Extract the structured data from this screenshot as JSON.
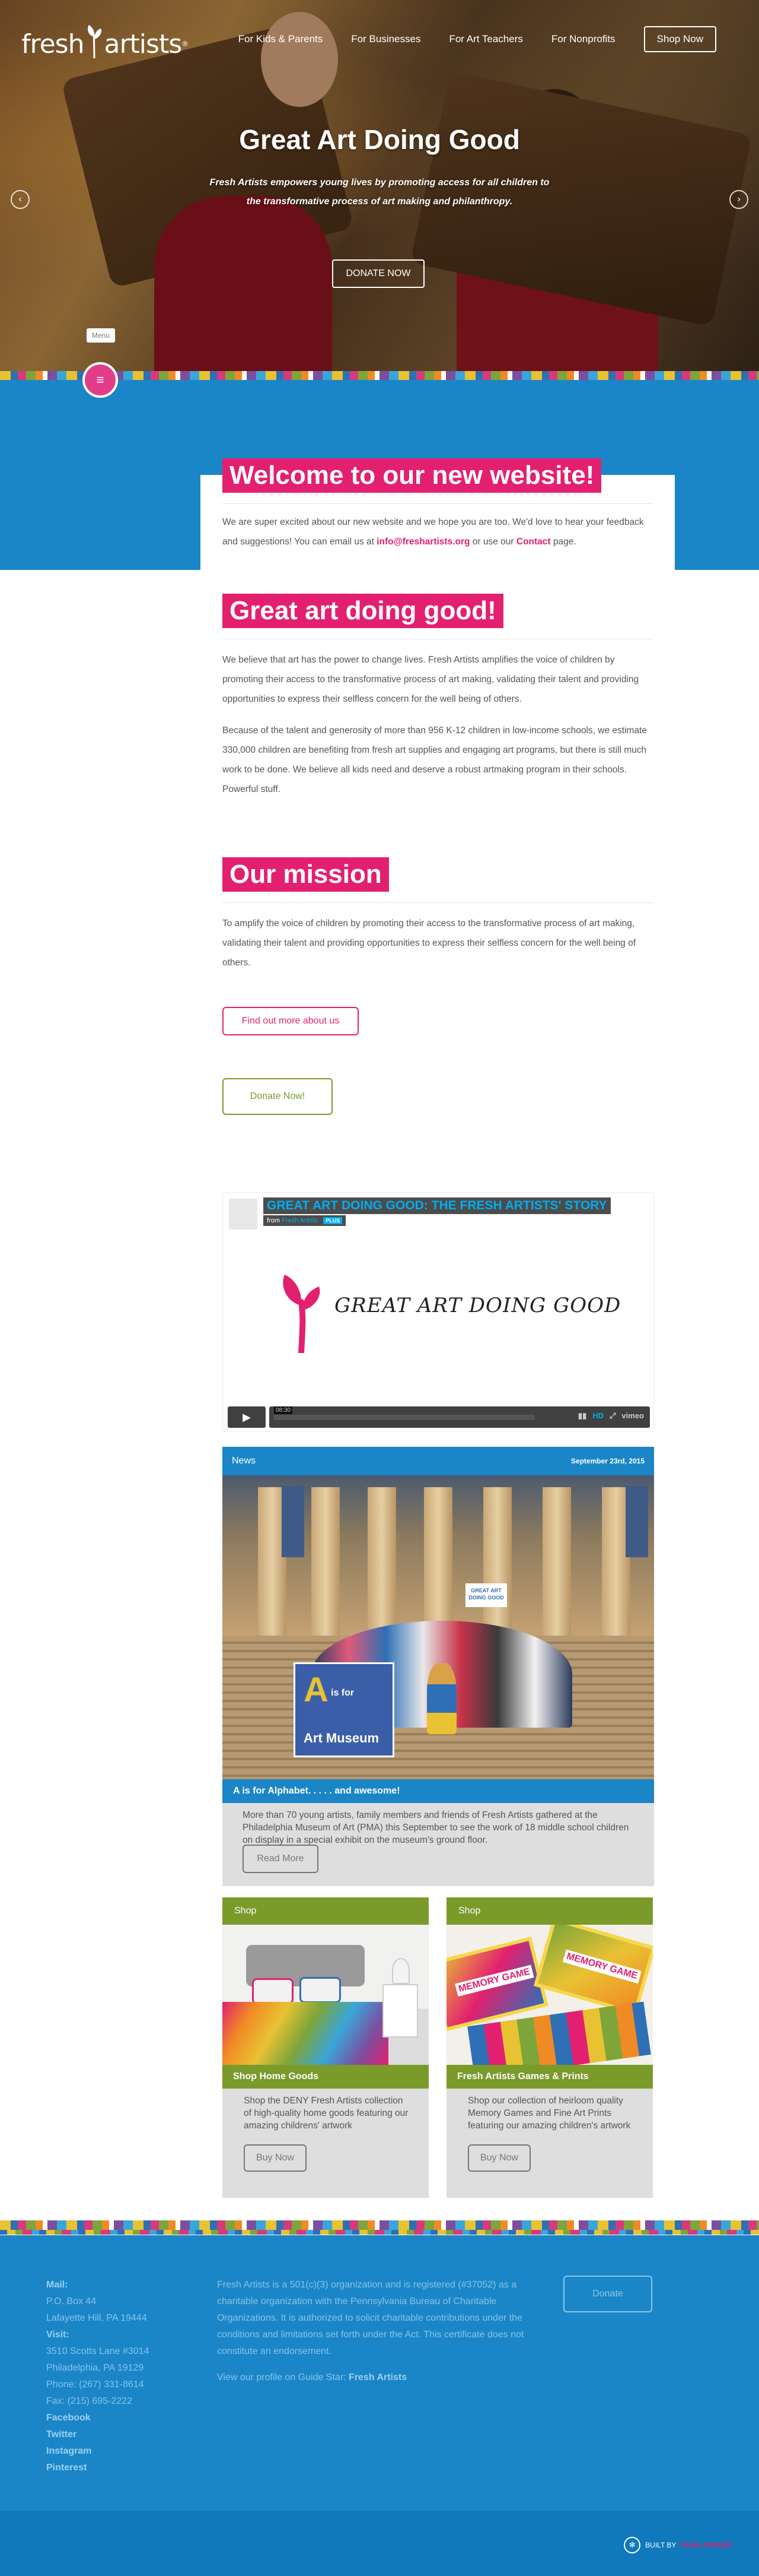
{
  "header": {
    "logo_left": "fresh",
    "logo_right": "artists",
    "logo_mark": "®",
    "nav": [
      "For Kids & Parents",
      "For Businesses",
      "For Art Teachers",
      "For Nonprofits"
    ],
    "shop_button": "Shop Now",
    "menu_label": "Menu"
  },
  "hero": {
    "title": "Great Art Doing Good",
    "subtitle": "Fresh Artists empowers young lives by promoting access for all children to the transformative process of art making and philanthropy.",
    "donate_button": "DONATE NOW"
  },
  "welcome": {
    "heading": "Welcome to our new website!",
    "text_before_email": "We are super excited about our new website and we hope you are too. We'd love to hear your feedback and suggestions! You can email us at ",
    "email": "info@freshartists.org",
    "text_middle": " or use our ",
    "contact_link": "Contact",
    "text_after": " page."
  },
  "great_art": {
    "heading": "Great art doing good!",
    "p1": "We believe that art has the power to change lives. Fresh Artists amplifies the voice of children by promoting their access to the transformative process of art making, validating their talent and providing opportunities to express their selfless concern for the well being of others.",
    "p2": "Because of the talent and generosity of more than 956 K-12 children in low-income schools, we estimate 330,000 children are benefiting from fresh art supplies and engaging art programs, but there is still much work to be done. We believe all kids need and deserve a robust artmaking program in their schools. Powerful stuff."
  },
  "mission": {
    "heading": "Our mission",
    "text": "To amplify the voice of children by promoting their access to the transformative process of art making, validating their talent and providing opportunities to express their selfless concern for the well being of others.",
    "about_button": "Find out more about us",
    "donate_button": "Donate Now!"
  },
  "video": {
    "title": "GREAT ART DOING GOOD: THE FRESH ARTISTS' STORY",
    "from": "from",
    "user": "Fresh Artists",
    "plus": "PLUS",
    "logo_text": "GREAT ART DOING GOOD",
    "time": "08:30",
    "hd": "HD",
    "vimeo": "vimeo"
  },
  "news": {
    "label": "News",
    "date": "September 23rd, 2015",
    "caption": "A is for Alphabet. . . . . and awesome!",
    "text": "More than 70 young artists, family members and friends of Fresh Artists gathered at the Philadelphia Museum of Art (PMA) this September to see the work of 18 middle school children on display in a special exhibit on the museum's ground floor.",
    "button": "Read More",
    "poster_line1": "A",
    "poster_line2": "is for",
    "poster_line3": "Art Museum",
    "sign_text": "GREAT ART DOING GOOD"
  },
  "shop_cards": [
    {
      "label": "Shop",
      "caption": "Shop Home Goods",
      "text": "Shop the DENY Fresh Artists collection of high-quality home goods featuring our amazing childrens' artwork",
      "button": "Buy Now"
    },
    {
      "label": "Shop",
      "caption": "Fresh Artists Games & Prints",
      "text": "Shop our collection of heirloom quality Memory Games and Fine Art Prints featuring our amazing children's artwork",
      "button": "Buy Now",
      "box_text": "MEMORY GAME"
    }
  ],
  "footer": {
    "mail_label": "Mail:",
    "mail_lines": [
      "P.O. Box 44",
      "Lafayette Hill, PA 19444"
    ],
    "visit_label": "Visit:",
    "visit_lines": [
      "3510 Scotts Lane #3014",
      "Philadelphia, PA 19129"
    ],
    "phone": "Phone: (267) 331-8614",
    "fax": "Fax: (215) 695-2222",
    "social": [
      "Facebook",
      "Twitter",
      "Instagram",
      "Pinterest"
    ],
    "about": "Fresh Artists is a 501(c)(3) organization and is registered (#37052) as a charitable organization with the Pennsylvania Bureau of Charitable Organizations. It is authorized to solicit charitable contributions under the conditions and limitations set forth under the Act. This certificate does not constitute an endorsement.",
    "guidestar_text": "View our profile on Guide Star: ",
    "guidestar_link": "Fresh Artists",
    "donate_button": "Donate",
    "built_by": "BUILT BY",
    "builder": "PUNA AVENUE"
  },
  "colors": {
    "pink": "#e3206f",
    "blue": "#1a86c7",
    "green": "#7a9a2a",
    "card_grey": "#dedede"
  }
}
